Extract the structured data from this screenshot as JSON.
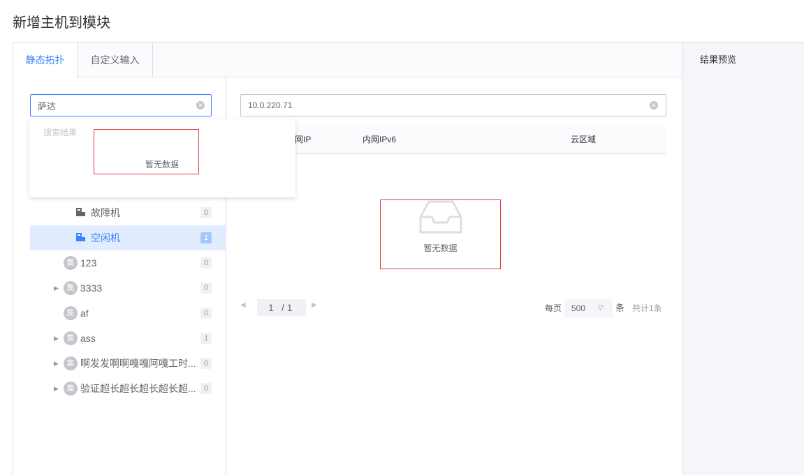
{
  "page": {
    "title": "新增主机到模块"
  },
  "tabs": {
    "static": "静态拓扑",
    "custom": "自定义输入"
  },
  "search": {
    "value": "萨达"
  },
  "dropdown": {
    "title": "搜索结果",
    "empty": "暂无数据"
  },
  "tree": {
    "leaves": [
      {
        "label": "故障机",
        "count": "0"
      },
      {
        "label": "空闲机",
        "count": "1"
      }
    ],
    "sets": [
      {
        "badge": "集",
        "label": "123",
        "count": "0",
        "arrow": ""
      },
      {
        "badge": "集",
        "label": "3333",
        "count": "0",
        "arrow": "▶"
      },
      {
        "badge": "集",
        "label": "af",
        "count": "0",
        "arrow": ""
      },
      {
        "badge": "集",
        "label": "ass",
        "count": "1",
        "arrow": "▶"
      },
      {
        "badge": "集",
        "label": "啊发发啊啊嘎嘎阿嘎工时...",
        "count": "0",
        "arrow": "▶"
      },
      {
        "badge": "集",
        "label": "验证超长超长超长超长超...",
        "count": "0",
        "arrow": "▶"
      }
    ]
  },
  "ip_filter": {
    "value": "10.0.220.71"
  },
  "table": {
    "headers": [
      "网IP",
      "内网IPv6",
      "云区域"
    ],
    "empty": "暂无数据"
  },
  "pagination": {
    "current": "1",
    "separator": "/ 1",
    "per_page_label": "每页",
    "page_size": "500",
    "unit": "条",
    "total": "共计1条"
  },
  "preview": {
    "title": "结果预览"
  }
}
